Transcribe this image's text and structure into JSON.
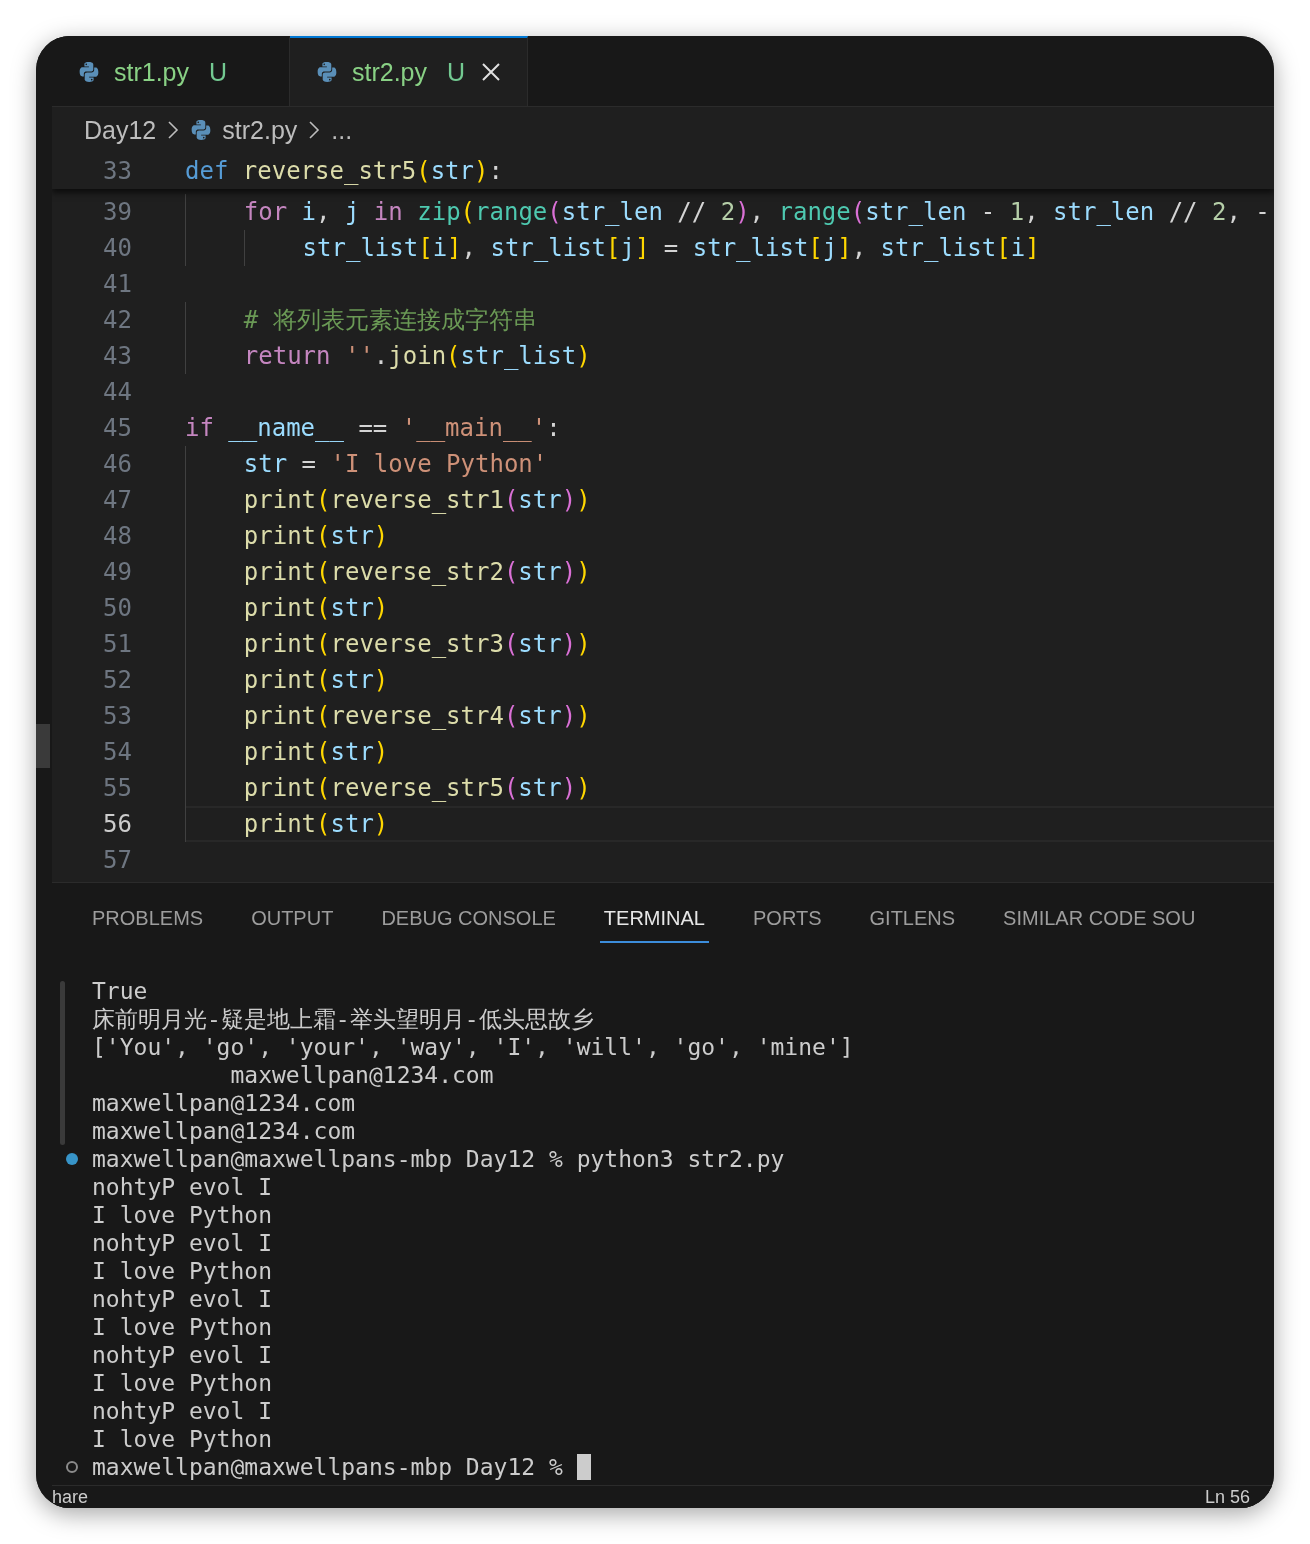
{
  "tabs": [
    {
      "label": "str1.py",
      "badge": "U",
      "selected": false
    },
    {
      "label": "str2.py",
      "badge": "U",
      "selected": true
    }
  ],
  "breadcrumb": [
    "Day12",
    "str2.py",
    "..."
  ],
  "sticky_line": {
    "number": "33",
    "tokens": [
      {
        "t": "def",
        "kind": "keyword"
      },
      {
        "t": " reverse_str5",
        "kind": "function"
      },
      {
        "t": "(",
        "kind": "bracket1"
      },
      {
        "t": "str",
        "kind": "variable"
      },
      {
        "t": ")",
        "kind": "bracket1"
      },
      {
        "t": ":",
        "kind": "punctuation"
      }
    ]
  },
  "lines": [
    {
      "number": "39",
      "current": false,
      "tokens": [
        {
          "t": "    for",
          "kind": "control"
        },
        {
          "t": " i",
          "kind": "variable"
        },
        {
          "t": ",",
          "kind": "punctuation"
        },
        {
          "t": " j",
          "kind": "variable"
        },
        {
          "t": " in",
          "kind": "control"
        },
        {
          "t": " zip",
          "kind": "builtin"
        },
        {
          "t": "(",
          "kind": "bracket1"
        },
        {
          "t": "range",
          "kind": "builtin"
        },
        {
          "t": "(",
          "kind": "bracket2"
        },
        {
          "t": "str_len",
          "kind": "variable"
        },
        {
          "t": " // ",
          "kind": "punctuation"
        },
        {
          "t": "2",
          "kind": "number"
        },
        {
          "t": ")",
          "kind": "bracket2"
        },
        {
          "t": ",",
          "kind": "punctuation"
        },
        {
          "t": " range",
          "kind": "builtin"
        },
        {
          "t": "(",
          "kind": "bracket2"
        },
        {
          "t": "str_len",
          "kind": "variable"
        },
        {
          "t": " - ",
          "kind": "punctuation"
        },
        {
          "t": "1",
          "kind": "number"
        },
        {
          "t": ",",
          "kind": "punctuation"
        },
        {
          "t": " str_len",
          "kind": "variable"
        },
        {
          "t": " // ",
          "kind": "punctuation"
        },
        {
          "t": "2",
          "kind": "number"
        },
        {
          "t": ", -",
          "kind": "punctuation"
        }
      ]
    },
    {
      "number": "40",
      "current": false,
      "tokens": [
        {
          "t": "        str_list",
          "kind": "variable"
        },
        {
          "t": "[",
          "kind": "bracket1"
        },
        {
          "t": "i",
          "kind": "variable"
        },
        {
          "t": "]",
          "kind": "bracket1"
        },
        {
          "t": ",",
          "kind": "punctuation"
        },
        {
          "t": " str_list",
          "kind": "variable"
        },
        {
          "t": "[",
          "kind": "bracket1"
        },
        {
          "t": "j",
          "kind": "variable"
        },
        {
          "t": "]",
          "kind": "bracket1"
        },
        {
          "t": " = ",
          "kind": "punctuation"
        },
        {
          "t": "str_list",
          "kind": "variable"
        },
        {
          "t": "[",
          "kind": "bracket1"
        },
        {
          "t": "j",
          "kind": "variable"
        },
        {
          "t": "]",
          "kind": "bracket1"
        },
        {
          "t": ",",
          "kind": "punctuation"
        },
        {
          "t": " str_list",
          "kind": "variable"
        },
        {
          "t": "[",
          "kind": "bracket1"
        },
        {
          "t": "i",
          "kind": "variable"
        },
        {
          "t": "]",
          "kind": "bracket1"
        }
      ]
    },
    {
      "number": "41",
      "current": false
    },
    {
      "number": "42",
      "current": false,
      "tokens": [
        {
          "t": "    # 将列表元素连接成字符串",
          "kind": "comment"
        }
      ]
    },
    {
      "number": "43",
      "current": false,
      "tokens": [
        {
          "t": "    return",
          "kind": "control"
        },
        {
          "t": " ''",
          "kind": "string"
        },
        {
          "t": ".",
          "kind": "punctuation"
        },
        {
          "t": "join",
          "kind": "function"
        },
        {
          "t": "(",
          "kind": "bracket1"
        },
        {
          "t": "str_list",
          "kind": "variable"
        },
        {
          "t": ")",
          "kind": "bracket1"
        }
      ]
    },
    {
      "number": "44",
      "current": false
    },
    {
      "number": "45",
      "current": false,
      "tokens": [
        {
          "t": "if",
          "kind": "control"
        },
        {
          "t": " __name__",
          "kind": "variable"
        },
        {
          "t": " == ",
          "kind": "punctuation"
        },
        {
          "t": "'__main__'",
          "kind": "string"
        },
        {
          "t": ":",
          "kind": "punctuation"
        }
      ]
    },
    {
      "number": "46",
      "current": false,
      "tokens": [
        {
          "t": "    str",
          "kind": "variable"
        },
        {
          "t": " = ",
          "kind": "punctuation"
        },
        {
          "t": "'I love Python'",
          "kind": "string"
        }
      ]
    },
    {
      "number": "47",
      "current": false,
      "tokens": [
        {
          "t": "    print",
          "kind": "function"
        },
        {
          "t": "(",
          "kind": "bracket1"
        },
        {
          "t": "reverse_str1",
          "kind": "function"
        },
        {
          "t": "(",
          "kind": "bracket2"
        },
        {
          "t": "str",
          "kind": "variable"
        },
        {
          "t": ")",
          "kind": "bracket2"
        },
        {
          "t": ")",
          "kind": "bracket1"
        }
      ]
    },
    {
      "number": "48",
      "current": false,
      "tokens": [
        {
          "t": "    print",
          "kind": "function"
        },
        {
          "t": "(",
          "kind": "bracket1"
        },
        {
          "t": "str",
          "kind": "variable"
        },
        {
          "t": ")",
          "kind": "bracket1"
        }
      ]
    },
    {
      "number": "49",
      "current": false,
      "tokens": [
        {
          "t": "    print",
          "kind": "function"
        },
        {
          "t": "(",
          "kind": "bracket1"
        },
        {
          "t": "reverse_str2",
          "kind": "function"
        },
        {
          "t": "(",
          "kind": "bracket2"
        },
        {
          "t": "str",
          "kind": "variable"
        },
        {
          "t": ")",
          "kind": "bracket2"
        },
        {
          "t": ")",
          "kind": "bracket1"
        }
      ]
    },
    {
      "number": "50",
      "current": false,
      "tokens": [
        {
          "t": "    print",
          "kind": "function"
        },
        {
          "t": "(",
          "kind": "bracket1"
        },
        {
          "t": "str",
          "kind": "variable"
        },
        {
          "t": ")",
          "kind": "bracket1"
        }
      ]
    },
    {
      "number": "51",
      "current": false,
      "tokens": [
        {
          "t": "    print",
          "kind": "function"
        },
        {
          "t": "(",
          "kind": "bracket1"
        },
        {
          "t": "reverse_str3",
          "kind": "function"
        },
        {
          "t": "(",
          "kind": "bracket2"
        },
        {
          "t": "str",
          "kind": "variable"
        },
        {
          "t": ")",
          "kind": "bracket2"
        },
        {
          "t": ")",
          "kind": "bracket1"
        }
      ]
    },
    {
      "number": "52",
      "current": false,
      "tokens": [
        {
          "t": "    print",
          "kind": "function"
        },
        {
          "t": "(",
          "kind": "bracket1"
        },
        {
          "t": "str",
          "kind": "variable"
        },
        {
          "t": ")",
          "kind": "bracket1"
        }
      ]
    },
    {
      "number": "53",
      "current": false,
      "tokens": [
        {
          "t": "    print",
          "kind": "function"
        },
        {
          "t": "(",
          "kind": "bracket1"
        },
        {
          "t": "reverse_str4",
          "kind": "function"
        },
        {
          "t": "(",
          "kind": "bracket2"
        },
        {
          "t": "str",
          "kind": "variable"
        },
        {
          "t": ")",
          "kind": "bracket2"
        },
        {
          "t": ")",
          "kind": "bracket1"
        }
      ]
    },
    {
      "number": "54",
      "current": false,
      "tokens": [
        {
          "t": "    print",
          "kind": "function"
        },
        {
          "t": "(",
          "kind": "bracket1"
        },
        {
          "t": "str",
          "kind": "variable"
        },
        {
          "t": ")",
          "kind": "bracket1"
        }
      ]
    },
    {
      "number": "55",
      "current": false,
      "tokens": [
        {
          "t": "    print",
          "kind": "function"
        },
        {
          "t": "(",
          "kind": "bracket1"
        },
        {
          "t": "reverse_str5",
          "kind": "function"
        },
        {
          "t": "(",
          "kind": "bracket2"
        },
        {
          "t": "str",
          "kind": "variable"
        },
        {
          "t": ")",
          "kind": "bracket2"
        },
        {
          "t": ")",
          "kind": "bracket1"
        }
      ]
    },
    {
      "number": "56",
      "current": true,
      "tokens": [
        {
          "t": "    print",
          "kind": "function"
        },
        {
          "t": "(",
          "kind": "bracket1"
        },
        {
          "t": "str",
          "kind": "variable"
        },
        {
          "t": ")",
          "kind": "bracket1"
        }
      ]
    },
    {
      "number": "57",
      "current": false
    }
  ],
  "panel_tabs": [
    {
      "label": "PROBLEMS",
      "selected": false
    },
    {
      "label": "OUTPUT",
      "selected": false
    },
    {
      "label": "DEBUG CONSOLE",
      "selected": false
    },
    {
      "label": "TERMINAL",
      "selected": true
    },
    {
      "label": "PORTS",
      "selected": false
    },
    {
      "label": "GITLENS",
      "selected": false
    },
    {
      "label": "SIMILAR CODE SOU",
      "selected": false
    }
  ],
  "terminal": [
    {
      "kind": "output",
      "text": "True"
    },
    {
      "kind": "output",
      "text": "床前明月光-疑是地上霜-举头望明月-低头思故乡"
    },
    {
      "kind": "output",
      "text": "['You', 'go', 'your', 'way', 'I', 'will', 'go', 'mine']"
    },
    {
      "kind": "output",
      "text": "          maxwellpan@1234.com"
    },
    {
      "kind": "output",
      "text": "maxwellpan@1234.com"
    },
    {
      "kind": "output",
      "text": "maxwellpan@1234.com"
    },
    {
      "kind": "finished",
      "text": "maxwellpan@maxwellpans-mbp Day12 % python3 str2.py"
    },
    {
      "kind": "output",
      "text": "nohtyP evol I"
    },
    {
      "kind": "output",
      "text": "I love Python"
    },
    {
      "kind": "output",
      "text": "nohtyP evol I"
    },
    {
      "kind": "output",
      "text": "I love Python"
    },
    {
      "kind": "output",
      "text": "nohtyP evol I"
    },
    {
      "kind": "output",
      "text": "I love Python"
    },
    {
      "kind": "output",
      "text": "nohtyP evol I"
    },
    {
      "kind": "output",
      "text": "I love Python"
    },
    {
      "kind": "output",
      "text": "nohtyP evol I"
    },
    {
      "kind": "output",
      "text": "I love Python"
    },
    {
      "kind": "prompt",
      "cursor": true,
      "text": "maxwellpan@maxwellpans-mbp Day12 %"
    }
  ],
  "status_bar": {
    "left": "hare",
    "right": "Ln 56"
  }
}
